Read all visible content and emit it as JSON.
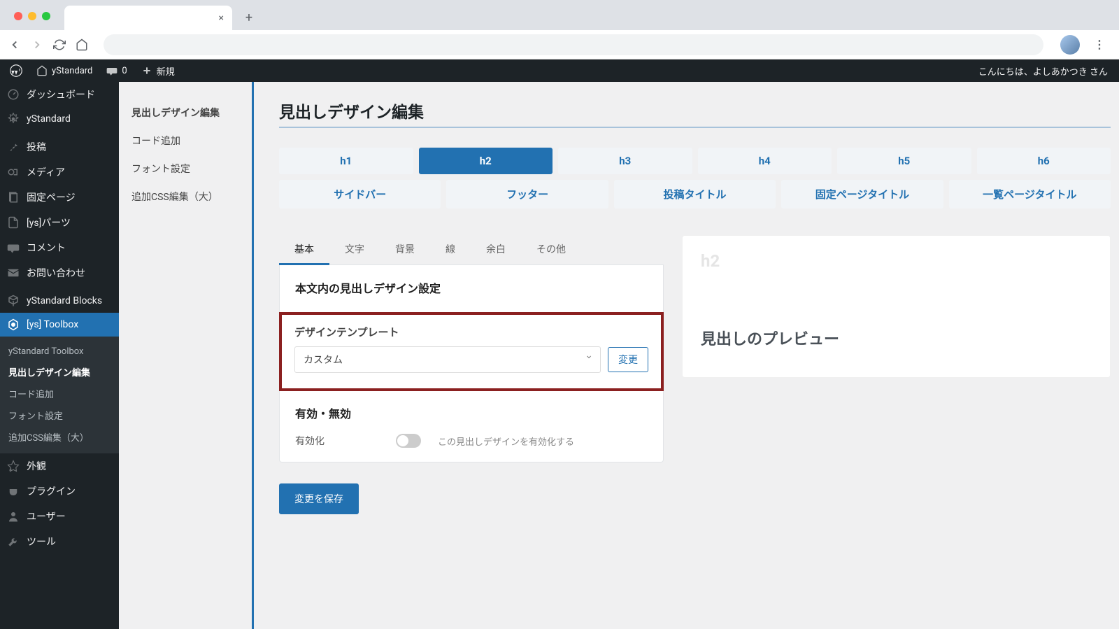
{
  "browser": {
    "tab_close": "×",
    "new_tab": "+"
  },
  "adminbar": {
    "site_name": "yStandard",
    "comments_count": "0",
    "new_label": "新規",
    "greeting": "こんにちは、よしあかつき さん"
  },
  "sidebar": {
    "dashboard": "ダッシュボード",
    "ystandard": "yStandard",
    "posts": "投稿",
    "media": "メディア",
    "pages": "固定ページ",
    "ys_parts": "[ys]パーツ",
    "comments": "コメント",
    "contact": "お問い合わせ",
    "ys_blocks": "yStandard Blocks",
    "ys_toolbox": "[ys] Toolbox",
    "submenu": {
      "toolbox": "yStandard Toolbox",
      "heading": "見出しデザイン編集",
      "code": "コード追加",
      "font": "フォント設定",
      "css": "追加CSS編集（大）"
    },
    "appearance": "外観",
    "plugins": "プラグイン",
    "users": "ユーザー",
    "tools": "ツール"
  },
  "secnav": {
    "heading": "見出しデザイン編集",
    "code": "コード追加",
    "font": "フォント設定",
    "css": "追加CSS編集（大）"
  },
  "main": {
    "page_title": "見出しデザイン編集",
    "h_tabs": [
      "h1",
      "h2",
      "h3",
      "h4",
      "h5",
      "h6"
    ],
    "h_tabs2": [
      "サイドバー",
      "フッター",
      "投稿タイトル",
      "固定ページタイトル",
      "一覧ページタイトル"
    ],
    "small_tabs": [
      "基本",
      "文字",
      "背景",
      "線",
      "余白",
      "その他"
    ],
    "section1_title": "本文内の見出しデザイン設定",
    "template_label": "デザインテンプレート",
    "template_value": "カスタム",
    "change_btn": "変更",
    "section2_title": "有効・無効",
    "toggle_label": "有効化",
    "toggle_desc": "この見出しデザインを有効化する",
    "save_btn": "変更を保存"
  },
  "preview": {
    "heading_tag": "h2",
    "preview_text": "見出しのプレビュー"
  }
}
